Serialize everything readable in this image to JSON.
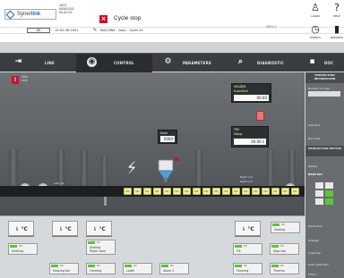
{
  "header": {
    "brand_prefix": "Syner",
    "brand_suffix": "link",
    "ids": [
      "4053",
      "00062002",
      "00.00.01"
    ],
    "cycle_status": "Cycle stop",
    "mode": "00",
    "clock": "15:02:36   0001",
    "machine": "MACHINE - Door - Open X1",
    "user_code": "0001 U",
    "buttons": [
      {
        "label": "LOGIN",
        "icon": "user-icon"
      },
      {
        "label": "HELP",
        "icon": "help-icon"
      },
      {
        "label": "EVENTS",
        "icon": "clock-icon"
      },
      {
        "label": "REPORTS",
        "icon": "bar-chart-icon"
      }
    ]
  },
  "nav": {
    "tabs": [
      {
        "label": "LINE",
        "icon": "line-icon"
      },
      {
        "label": "CONTROL",
        "icon": "control-icon",
        "active": true
      },
      {
        "label": "PARAMETERS",
        "icon": "parameters-icon"
      },
      {
        "label": "DIAGNOSTIC",
        "icon": "search-icon"
      },
      {
        "label": "DOC",
        "icon": "doc-icon"
      }
    ]
  },
  "alarm": {
    "line1": "Mise",
    "line2": "aide"
  },
  "machine": {
    "reel_left_labels": [
      "Left roll",
      "Left roll"
    ],
    "reel_right_labels": [
      "Right roll",
      "Right roll"
    ],
    "param_box_1": {
      "title": "HEADER",
      "status": "Inactive",
      "value": "00.00"
    },
    "param_box_2": {
      "title": "Dose",
      "value": "0000"
    },
    "param_box_3": {
      "title": "TIM",
      "status": "Stop",
      "value": "00.00 s"
    },
    "pucks": [
      "Dir",
      "Dir",
      "Dir",
      "Dir",
      "Dir",
      "Dir",
      "Dir",
      "Dir",
      "Dir",
      "Dir",
      "Dir",
      "Dir",
      "Dir",
      "Dir",
      "Dir",
      "Dir",
      "Dir",
      "Dir"
    ]
  },
  "right_panel": {
    "head1": "PRODUCTION INFORMATION",
    "number_of_cups": "Number of cups",
    "sub_time": "Sub time",
    "run_time": "Run time",
    "head2": "PRODUCTION SECTOR",
    "recipe": "Recipe",
    "base": "BASE P07",
    "production": "Production",
    "lineage": "Lineage",
    "cycle_top": "Cycle top",
    "auto": "Auto automatic",
    "time_ref": "Time s"
  },
  "bottom": {
    "temp_unit": "°C",
    "stats_row1": [
      {
        "num": "00",
        "label": "Heating"
      },
      {
        "num": "00",
        "label": "Sealing\nPaper zone"
      },
      {
        "num": "00",
        "label": "Dosing"
      },
      {
        "num": "00",
        "label": "Sealing"
      }
    ],
    "stats_row2": [
      {
        "num": "00",
        "label": "Heating fan"
      },
      {
        "num": "00",
        "label": "Forming"
      },
      {
        "num": "00",
        "label": "Ladle"
      },
      {
        "num": "00",
        "label": "Valve 1"
      },
      {
        "num": "00",
        "label": "Fill"
      },
      {
        "num": "00",
        "label": "Stop tab"
      },
      {
        "num": "00",
        "label": "Forming"
      },
      {
        "num": "00",
        "label": "Thermo"
      }
    ]
  },
  "colors": {
    "accent_red": "#c8102e",
    "ok_green": "#5dc43a",
    "nav_dark": "#3a3d40"
  }
}
